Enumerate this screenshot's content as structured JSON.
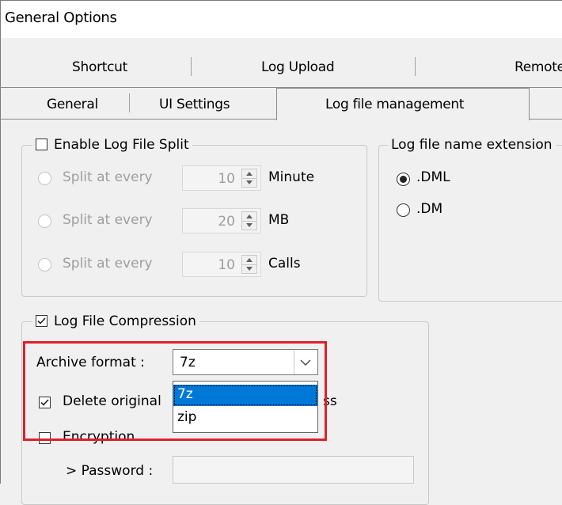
{
  "window": {
    "title": "General Options"
  },
  "top_tabs": [
    {
      "label": "Shortcut"
    },
    {
      "label": "Log Upload"
    },
    {
      "label": "Remote"
    }
  ],
  "tabs": [
    {
      "label": "General",
      "active": false
    },
    {
      "label": "UI Settings",
      "active": false
    },
    {
      "label": "Log file management",
      "active": true
    }
  ],
  "split_group": {
    "checkbox_label": "Enable Log File Split",
    "checked": false,
    "options": [
      {
        "radio_label": "Split at every",
        "value": "10",
        "unit": "Minute"
      },
      {
        "radio_label": "Split at every",
        "value": "20",
        "unit": "MB"
      },
      {
        "radio_label": "Split at every",
        "value": "10",
        "unit": "Calls"
      }
    ]
  },
  "extension_group": {
    "title": "Log file name extension",
    "options": [
      {
        "label": ".DML",
        "selected": true
      },
      {
        "label": ".DM",
        "selected": false
      }
    ]
  },
  "compression_group": {
    "checkbox_label": "Log File Compression",
    "checked": true,
    "archive_label": "Archive format :",
    "archive_value": "7z",
    "dropdown_options": [
      "7z",
      "zip"
    ],
    "delete_label_visible": "Delete original",
    "delete_label_tail": "ss",
    "delete_checked": true,
    "encryption_label": "Encryption",
    "password_label": "> Password :"
  },
  "colors": {
    "highlight": "#0078d7",
    "callout": "#e0202a"
  }
}
